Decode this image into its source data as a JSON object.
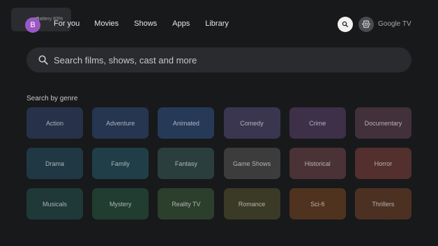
{
  "status": {
    "battery_text": "Battery 83%"
  },
  "profile": {
    "initial": "B",
    "color": "#9b58c4"
  },
  "nav": {
    "items": [
      {
        "label": "For you"
      },
      {
        "label": "Movies"
      },
      {
        "label": "Shows"
      },
      {
        "label": "Apps"
      },
      {
        "label": "Library"
      }
    ],
    "search_icon": "search-icon",
    "settings_icon": "gear-icon",
    "brand": "Google TV"
  },
  "search": {
    "placeholder": "Search films, shows, cast and more"
  },
  "genres": {
    "heading": "Search by genre",
    "items": [
      {
        "label": "Action",
        "color": "#27324a"
      },
      {
        "label": "Adventure",
        "color": "#263550"
      },
      {
        "label": "Animated",
        "color": "#263a58"
      },
      {
        "label": "Comedy",
        "color": "#3a3650"
      },
      {
        "label": "Crime",
        "color": "#3d3048"
      },
      {
        "label": "Documentary",
        "color": "#42303a"
      },
      {
        "label": "Drama",
        "color": "#203844"
      },
      {
        "label": "Family",
        "color": "#203e48"
      },
      {
        "label": "Fantasy",
        "color": "#2a3e3e"
      },
      {
        "label": "Game Shows",
        "color": "#3c3c3c"
      },
      {
        "label": "Historical",
        "color": "#4a3236"
      },
      {
        "label": "Horror",
        "color": "#532f2d"
      },
      {
        "label": "Musicals",
        "color": "#1f3838"
      },
      {
        "label": "Mystery",
        "color": "#213c30"
      },
      {
        "label": "Reality TV",
        "color": "#2c3e2c"
      },
      {
        "label": "Romance",
        "color": "#3b3a26"
      },
      {
        "label": "Sci-fi",
        "color": "#4f331e"
      },
      {
        "label": "Thrillers",
        "color": "#4c3022"
      }
    ]
  }
}
